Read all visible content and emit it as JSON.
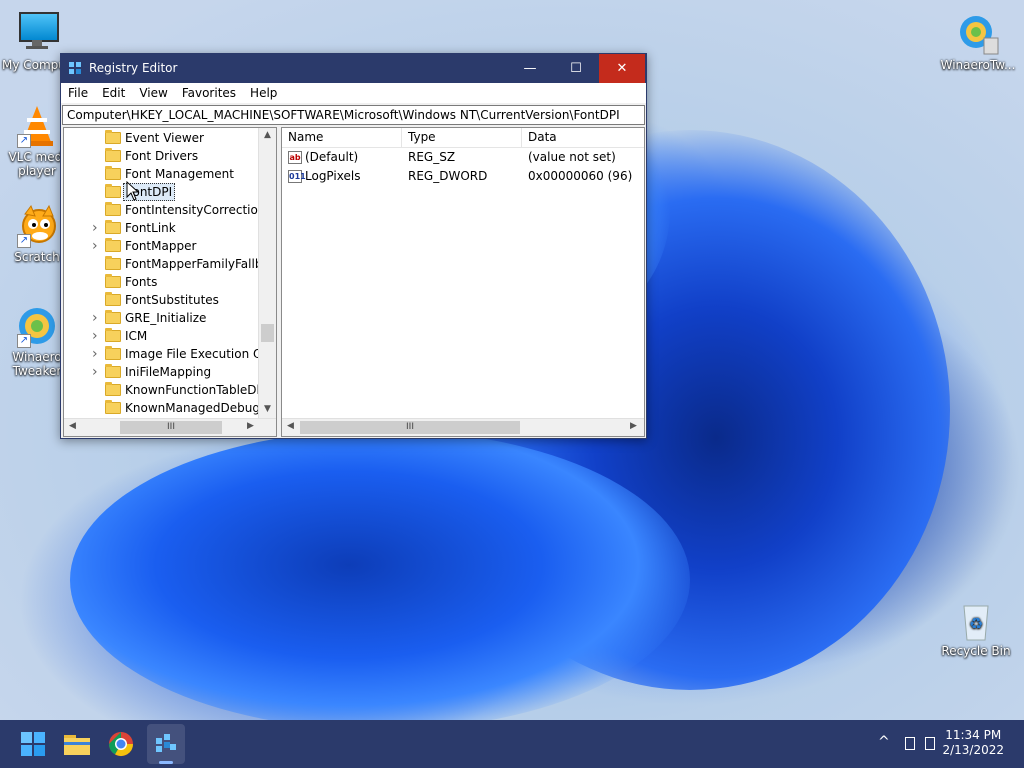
{
  "desktop": {
    "icons_left": [
      {
        "label": "My Compu",
        "icon": "monitor-icon"
      },
      {
        "label": "VLC medi",
        "label2": "player",
        "icon": "vlc-cone-icon"
      },
      {
        "label": "Scratch",
        "icon": "scratch-cat-icon"
      },
      {
        "label": "Winaero",
        "label2": "Tweaker",
        "icon": "winaero-tweaker-icon"
      }
    ],
    "icons_right": [
      {
        "label": "WinaeroTw...",
        "icon": "winaero-tweaker-icon"
      },
      {
        "label": "Recycle Bin",
        "icon": "recycle-bin-icon"
      }
    ]
  },
  "window": {
    "title": "Registry Editor",
    "buttons": {
      "minimize": "—",
      "maximize": "☐",
      "close": "✕"
    },
    "menu": [
      "File",
      "Edit",
      "View",
      "Favorites",
      "Help"
    ],
    "address": "Computer\\HKEY_LOCAL_MACHINE\\SOFTWARE\\Microsoft\\Windows NT\\CurrentVersion\\FontDPI",
    "tree": [
      {
        "label": "Event Viewer",
        "expandable": false
      },
      {
        "label": "Font Drivers",
        "expandable": false
      },
      {
        "label": "Font Management",
        "expandable": false
      },
      {
        "label": "FontDPI",
        "expandable": false,
        "selected": true
      },
      {
        "label": "FontIntensityCorrection",
        "expandable": false
      },
      {
        "label": "FontLink",
        "expandable": true
      },
      {
        "label": "FontMapper",
        "expandable": true
      },
      {
        "label": "FontMapperFamilyFallbac",
        "expandable": false
      },
      {
        "label": "Fonts",
        "expandable": false
      },
      {
        "label": "FontSubstitutes",
        "expandable": false
      },
      {
        "label": "GRE_Initialize",
        "expandable": true
      },
      {
        "label": "ICM",
        "expandable": true
      },
      {
        "label": "Image File Execution Opt",
        "expandable": true
      },
      {
        "label": "IniFileMapping",
        "expandable": true
      },
      {
        "label": "KnownFunctionTableDlls",
        "expandable": false
      },
      {
        "label": "KnownManagedDebuggi",
        "expandable": false
      }
    ],
    "list": {
      "columns": [
        "Name",
        "Type",
        "Data"
      ],
      "rows": [
        {
          "name": "(Default)",
          "type": "REG_SZ",
          "data": "(value not set)",
          "icon": "ab"
        },
        {
          "name": "LogPixels",
          "type": "REG_DWORD",
          "data": "0x00000060 (96)",
          "icon": "011"
        }
      ]
    },
    "scroll_glyph": "III"
  },
  "taskbar": {
    "clock": {
      "time": "11:34 PM",
      "date": "2/13/2022"
    },
    "tray_chevron": "^"
  }
}
